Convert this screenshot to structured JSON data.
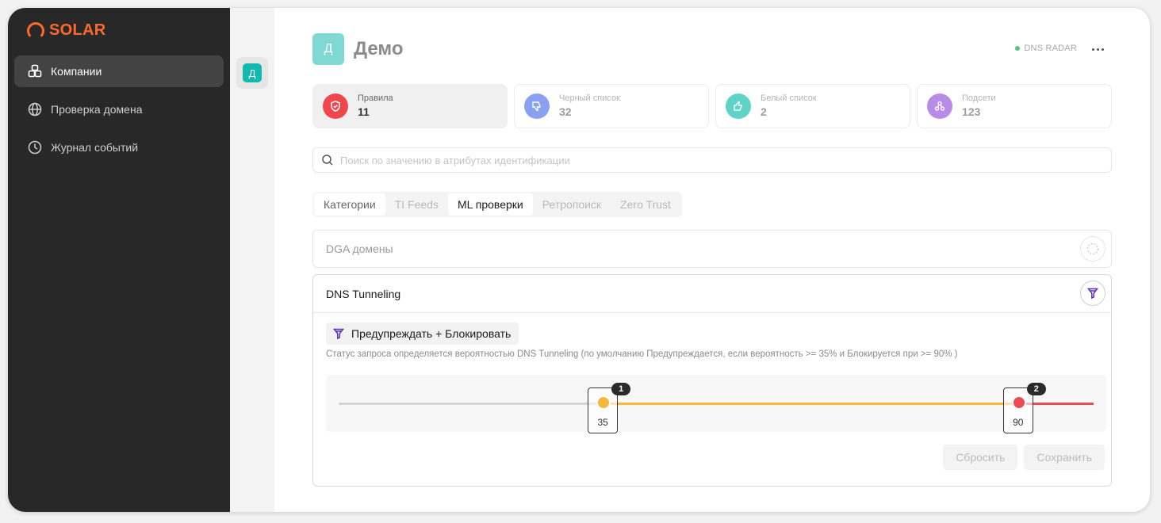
{
  "brand": {
    "name": "SOLAR",
    "color": "#ff6a2c"
  },
  "sidebar": {
    "items": [
      {
        "label": "Компании",
        "icon": "building-blocks-icon",
        "active": true
      },
      {
        "label": "Проверка домена",
        "icon": "globe-icon",
        "active": false
      },
      {
        "label": "Журнал событий",
        "icon": "clock-icon",
        "active": false
      }
    ]
  },
  "subnav": {
    "avatar_letter": "Д",
    "avatar_color": "#12b9ad"
  },
  "header": {
    "avatar_letter": "Д",
    "title": "Демо",
    "status_label": "DNS RADAR",
    "status_color": "#52c878"
  },
  "stats": [
    {
      "label": "Правила",
      "value": "11",
      "icon": "shield-icon",
      "color": "#f0474f"
    },
    {
      "label": "Черный список",
      "value": "32",
      "icon": "thumbs-down-icon",
      "color": "#8aa0f0"
    },
    {
      "label": "Белый список",
      "value": "2",
      "icon": "thumbs-up-icon",
      "color": "#5fd3c8"
    },
    {
      "label": "Подсети",
      "value": "123",
      "icon": "network-icon",
      "color": "#b98be8"
    }
  ],
  "search": {
    "placeholder": "Поиск по значению в атрибутах идентификации",
    "value": ""
  },
  "tabs": [
    "Категории",
    "TI Feeds",
    "ML проверки",
    "Ретропоиск",
    "Zero Trust"
  ],
  "active_tab": "ML проверки",
  "panels": {
    "dga": {
      "title": "DGA домены"
    },
    "dns": {
      "title": "DNS Tunneling",
      "mode": "Предупреждать + Блокировать",
      "description": "Статус запроса определяется вероятностью  DNS Tunneling (по умолчанию Предупреждается, если вероятность >= 35% и Блокируется при  >= 90% )"
    }
  },
  "slider": {
    "min": 0,
    "max": 100,
    "thresholds": [
      {
        "badge": "1",
        "value": 35,
        "color": "#f5b83a"
      },
      {
        "badge": "2",
        "value": 90,
        "color": "#ee4b55"
      }
    ]
  },
  "buttons": {
    "reset": "Сбросить",
    "save": "Сохранить"
  }
}
